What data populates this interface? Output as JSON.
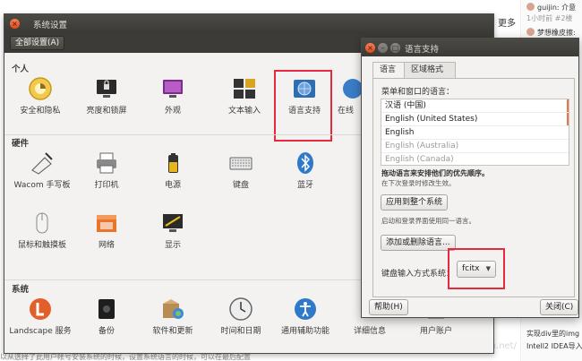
{
  "background": {
    "top_right_more": "更多",
    "side": [
      {
        "text": "guijin: 介意",
        "gray": false
      },
      {
        "text": "1小时前 #2楼",
        "gray": true
      },
      {
        "text": "梦想橡皮擦:",
        "gray": false
      },
      {
        "text": "Intell2 IDEA导入",
        "gray": false
      },
      {
        "text": "实现div里的img",
        "gray": false
      }
    ],
    "bottom_text": "以从选择了此用户帐号安装系统的时候，设置系统语言的时候，可以在最后配置",
    "watermark": "https://blog.csdn.net/"
  },
  "settings": {
    "title": "系统设置",
    "all_settings": "全部设置(A)",
    "sections": {
      "personal": "个人",
      "hardware": "硬件",
      "system": "系统"
    },
    "personal_items": [
      "安全和隐私",
      "亮度和锁屏",
      "外观",
      "文本输入",
      "语言支持",
      "在线"
    ],
    "hardware_items": [
      "Wacom 手写板",
      "打印机",
      "电源",
      "键盘",
      "蓝牙",
      "鼠标和触摸板",
      "网络",
      "显示"
    ],
    "system_items": [
      "Landscape 服务",
      "备份",
      "软件和更新",
      "时间和日期",
      "通用辅助功能",
      "详细信息",
      "用户账户"
    ]
  },
  "language_dialog": {
    "title": "语言支持",
    "tabs": [
      "语言",
      "区域格式"
    ],
    "menu_label": "菜单和窗口的语言：",
    "languages": [
      {
        "name": "汉语 (中国)",
        "muted": false
      },
      {
        "name": "English (United States)",
        "muted": false
      },
      {
        "name": "English",
        "muted": false
      },
      {
        "name": "English (Australia)",
        "muted": true
      },
      {
        "name": "English (Canada)",
        "muted": true
      }
    ],
    "drag_hint": "拖动语言来安排他们的优先顺序。",
    "effect_hint": "在下次登录时修改生效。",
    "apply_button": "应用到整个系统",
    "apply_hint": "启动和登录界面使用同一语言。",
    "install_button": "添加或删除语言...",
    "keyboard_label": "键盘输入方式系统：",
    "keyboard_value": "fcitx",
    "help_button": "帮助(H)",
    "close_button": "关闭(C)"
  },
  "colors": {
    "highlight": "#e8283b",
    "titlebar": "#3c3b37",
    "window_bg": "#f3f2f0"
  }
}
